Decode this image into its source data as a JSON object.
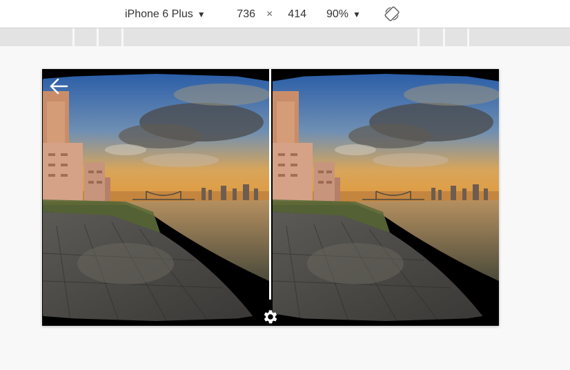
{
  "toolbar": {
    "device": "iPhone 6 Plus",
    "width": "736",
    "times": "×",
    "height": "414",
    "zoom": "90%",
    "caret": "▼"
  },
  "icons": {
    "device_dropdown": "caret-down-icon",
    "zoom_dropdown": "caret-down-icon",
    "rotate": "rotate-icon",
    "back": "back-arrow-icon",
    "settings": "gear-icon"
  },
  "colors": {
    "toolbar_bg": "#ffffff",
    "ruler_bg": "#e3e3e3",
    "page_bg": "#f8f8f8",
    "viewport_bg": "#000000",
    "divider": "#ffffff"
  }
}
